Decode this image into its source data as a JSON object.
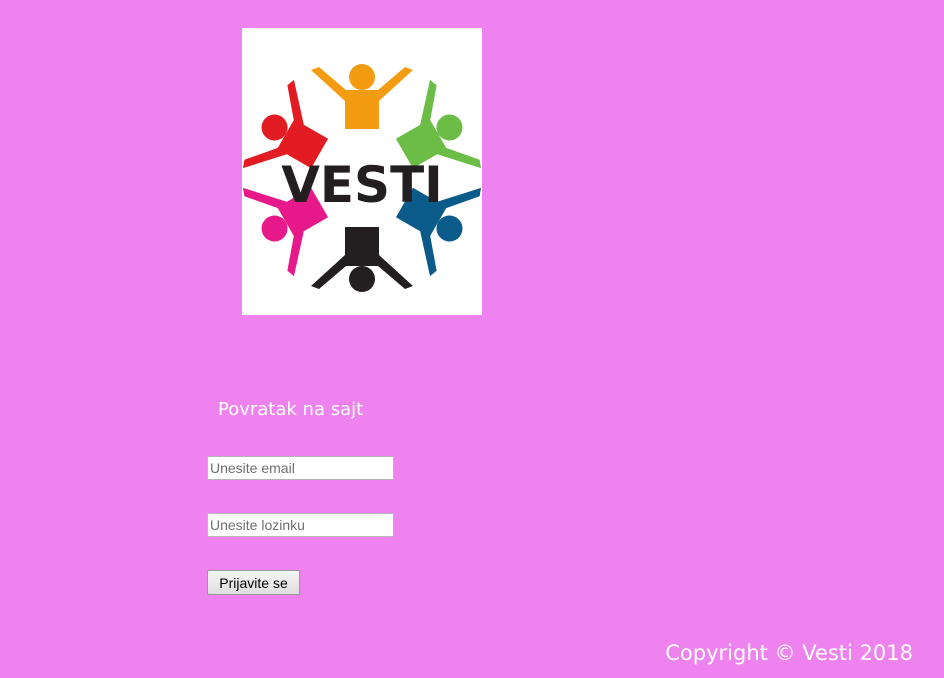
{
  "logo": {
    "text": "VESTI",
    "figure_colors": [
      "#f39c12",
      "#6cbd45",
      "#0a5a8a",
      "#231f20",
      "#e6188a",
      "#e31b23"
    ]
  },
  "nav": {
    "back_link": "Povratak na sajt"
  },
  "form": {
    "email_placeholder": "Unesite email",
    "password_placeholder": "Unesite lozinku",
    "submit_label": "Prijavite se"
  },
  "footer": {
    "copyright": "Copyright © Vesti 2018"
  },
  "colors": {
    "background": "#ee82ee",
    "text": "#ffffff"
  }
}
